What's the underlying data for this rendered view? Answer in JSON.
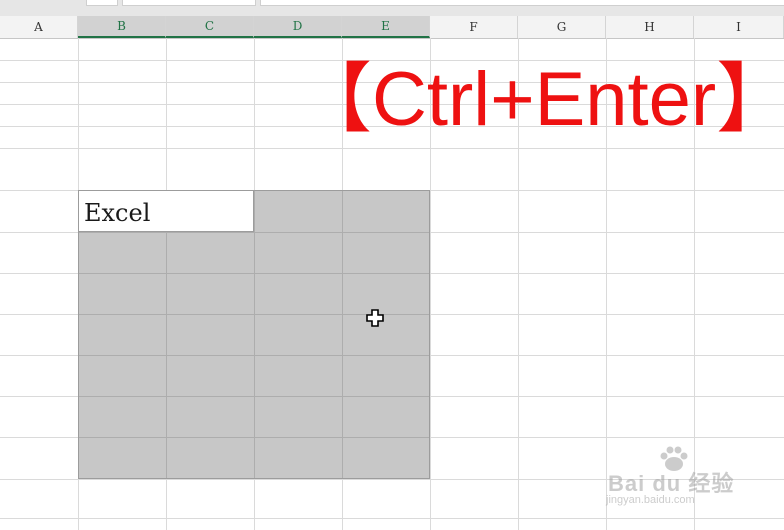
{
  "columns": [
    {
      "label": "A",
      "selected": false
    },
    {
      "label": "B",
      "selected": true
    },
    {
      "label": "C",
      "selected": true
    },
    {
      "label": "D",
      "selected": true
    },
    {
      "label": "E",
      "selected": true
    },
    {
      "label": "F",
      "selected": false
    },
    {
      "label": "G",
      "selected": false
    },
    {
      "label": "H",
      "selected": false
    },
    {
      "label": "I",
      "selected": false
    }
  ],
  "active_cell_text": "Excel",
  "overlay_title": "【Ctrl+Enter】",
  "cursor_icon": "cross-cursor-icon",
  "watermark": {
    "logo": "Bai du 经验",
    "url": "jingyan.baidu.com"
  },
  "colors": {
    "accent": "#217346",
    "selection_fill": "#c7c7c7",
    "overlay_text": "#ee1111"
  }
}
